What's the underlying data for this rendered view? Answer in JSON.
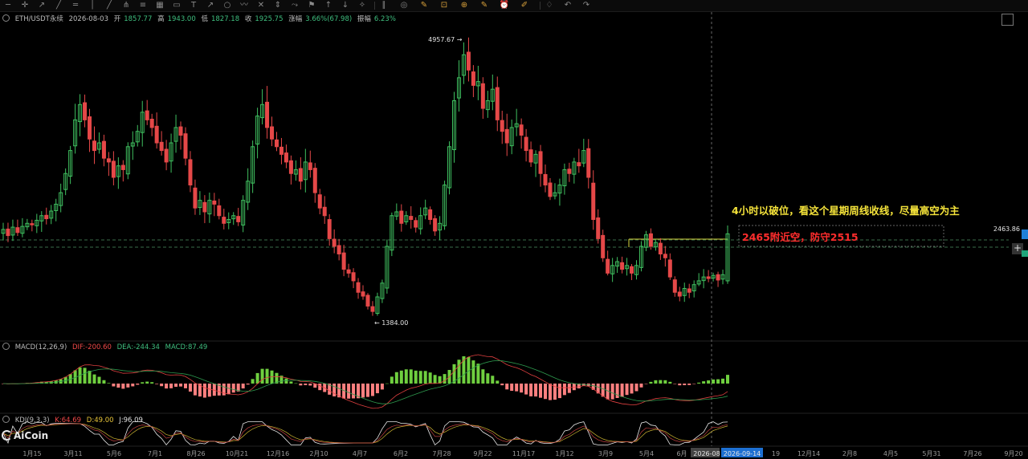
{
  "toolbar": {
    "icons": [
      "line-tool-icon",
      "crosshair-icon",
      "ray-icon",
      "trend-line-icon",
      "horizontal-line-icon",
      "vertical-line-icon",
      "parallel-channel-icon",
      "pitchfork-icon",
      "fib-icon",
      "gann-icon",
      "rectangle-icon",
      "text-icon",
      "arrow-icon",
      "circle-icon",
      "brush-icon",
      "x-icon",
      "measure-icon",
      "polyline-icon",
      "flag-icon",
      "long-position-icon",
      "short-position-icon",
      "magnet-icon",
      "lock-icon",
      "hide-icon",
      "delete-icon",
      "screenshot-icon",
      "zoom-icon",
      "note-icon",
      "alert-icon",
      "ruler-icon",
      "layers-icon",
      "undo-icon",
      "redo-icon"
    ],
    "glyphs": [
      "─",
      "✛",
      "↗",
      "╱",
      "═",
      "│",
      "╱",
      "⋔",
      "≡",
      "▦",
      "▭",
      "T",
      "↗",
      "○",
      "〰",
      "✕",
      "⇕",
      "⤳",
      "⚑",
      "↑",
      "↓",
      "✧",
      "∥",
      "◎",
      "✎",
      "⊡",
      "⊕",
      "✎",
      "⏰",
      "✐",
      "♢",
      "↶",
      "↷"
    ]
  },
  "header": {
    "symbol": "ETH/USDT永续",
    "date": "2026-08-03",
    "open_label": "开",
    "open": "1857.77",
    "high_label": "高",
    "high": "1943.00",
    "low_label": "低",
    "low": "1827.18",
    "close_label": "收",
    "close": "1925.75",
    "change_label": "涨幅",
    "change": "3.66%(67.98)",
    "amp_label": "振幅",
    "amp": "6.23%"
  },
  "macd_header": {
    "name": "MACD(12,26,9)",
    "dif": "DIF:-200.60",
    "dea": "DEA:-244.34",
    "macd": "MACD:87.49"
  },
  "kdj_header": {
    "name": "KDJ(9,3,3)",
    "k": "K:64.69",
    "d": "D:49.00",
    "j": "J:96.09"
  },
  "annotations": {
    "line1": "4小时以破位，看这个星期周线收线，尽量高空为主",
    "line2": "2465附近空，防守2515"
  },
  "price_labels": {
    "high": "4957.67",
    "low": "1384.00",
    "current": "2463.86"
  },
  "logo": "AiCoin",
  "colors": {
    "up": "#3fbf5f",
    "down": "#e54848",
    "macd_up": "#6fcf3f",
    "macd_down": "#ff8080",
    "annotation1": "#f5e33a",
    "annotation2": "#ff2d2d"
  },
  "chart_data": {
    "type": "candlestick",
    "symbol": "ETH/USDT",
    "x_ticks": [
      "1月15",
      "3月11",
      "5月6",
      "7月1",
      "8月26",
      "10月21",
      "12月16",
      "2月10",
      "4月7",
      "6月2",
      "7月28",
      "9月22",
      "11月17",
      "1月12",
      "3月9",
      "5月4",
      "6月",
      "2026-08",
      "2026-09-14",
      "19",
      "12月14",
      "2月8",
      "4月5",
      "5月31",
      "7月26",
      "9月20"
    ],
    "y_range": [
      1200,
      5200
    ],
    "closes": [
      2520,
      2440,
      2550,
      2480,
      2560,
      2600,
      2580,
      2640,
      2700,
      2660,
      2760,
      2850,
      3000,
      3250,
      3550,
      3950,
      4150,
      3950,
      3700,
      3550,
      3650,
      3450,
      3400,
      3200,
      3350,
      3300,
      3600,
      3650,
      3800,
      4050,
      3950,
      3850,
      3650,
      3550,
      3400,
      3650,
      3850,
      3750,
      3450,
      3100,
      2800,
      2900,
      2750,
      2900,
      2850,
      2700,
      2600,
      2650,
      2700,
      2620,
      2900,
      3150,
      3600,
      4000,
      4150,
      3850,
      3700,
      3600,
      3500,
      3400,
      3250,
      3300,
      3150,
      3400,
      3300,
      3000,
      2800,
      2700,
      2400,
      2300,
      2200,
      2000,
      1950,
      1850,
      1700,
      1650,
      1520,
      1450,
      1640,
      1820,
      2300,
      2700,
      2750,
      2600,
      2700,
      2650,
      2550,
      2700,
      2800,
      2650,
      2500,
      2600,
      3100,
      3600,
      4200,
      4500,
      4800,
      4600,
      4400,
      4450,
      4100,
      4200,
      4350,
      3950,
      3800,
      3650,
      3850,
      3900,
      3750,
      3550,
      3400,
      3500,
      3250,
      3100,
      2950,
      3000,
      3100,
      3300,
      3250,
      3400,
      3350,
      3550,
      3200,
      2650,
      2400,
      2150,
      1950,
      2050,
      2100,
      2000,
      2050,
      1950,
      2050,
      2300,
      2450,
      2300,
      2350,
      2200,
      2150,
      1900,
      1700,
      1650,
      1750,
      1700,
      1800,
      1850,
      1900,
      1880,
      1920,
      1860,
      1930,
      2463
    ],
    "high_marker": 4957.67,
    "low_marker": 1384.0,
    "last_price": 2463.86,
    "levels": [
      2465,
      2515
    ],
    "macd": {
      "dif": -200.6,
      "dea": -244.34,
      "macd": 87.49
    },
    "kdj": {
      "k": 64.69,
      "d": 49.0,
      "j": 96.09
    }
  }
}
